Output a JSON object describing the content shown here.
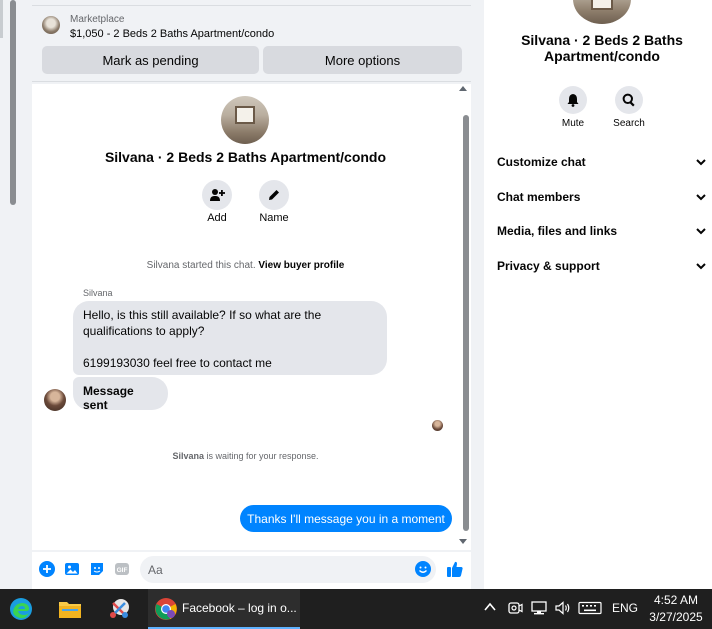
{
  "marketplace": {
    "label": "Marketplace",
    "title": "$1,050 - 2 Beds 2 Baths Apartment/condo",
    "pending_label": "Mark as pending",
    "more_label": "More options"
  },
  "conversation": {
    "profile_name": "Silvana · 2 Beds 2 Baths Apartment/condo",
    "add_label": "Add",
    "name_label": "Name",
    "started_text": "Silvana started this chat.",
    "view_profile_link": "View buyer profile",
    "sender_name": "Silvana",
    "incoming_line1": "Hello, is this still available? If so what are the",
    "incoming_line2": "qualifications to apply?",
    "incoming_line3": "6199193030 feel free to contact me",
    "sent_status": "Message sent",
    "waiting_name": "Silvana",
    "waiting_text": "is waiting for your response.",
    "outgoing_message": "Thanks I'll message you in a moment"
  },
  "composer": {
    "placeholder": "Aa"
  },
  "right_panel": {
    "name": "Silvana · 2 Beds 2 Baths Apartment/condo",
    "mute_label": "Mute",
    "search_label": "Search",
    "sections": [
      "Customize chat",
      "Chat members",
      "Media, files and links",
      "Privacy & support"
    ]
  },
  "taskbar": {
    "app_label": "Facebook – log in o...",
    "language": "ENG",
    "time": "4:52 AM",
    "date": "3/27/2025"
  },
  "colors": {
    "accent": "#0084ff",
    "bubble_gray": "#e4e6eb",
    "taskbar": "#1f1f1f"
  }
}
